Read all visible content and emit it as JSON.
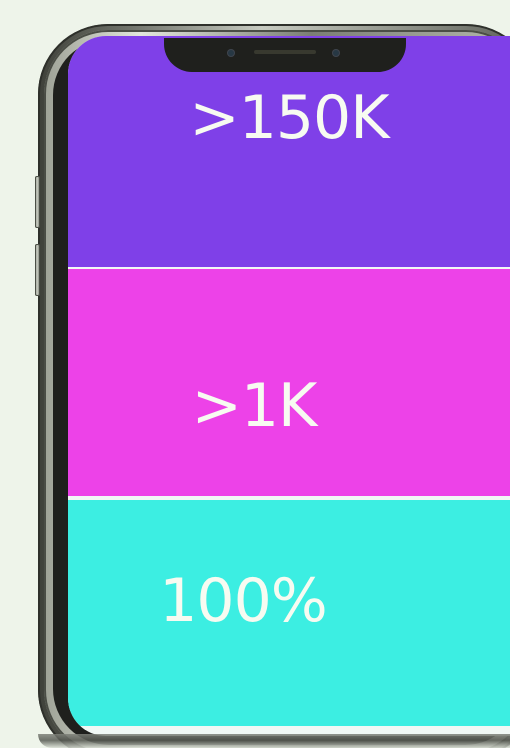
{
  "stats": [
    {
      "value": ">150K"
    },
    {
      "value": ">1K"
    },
    {
      "value": "100%"
    }
  ],
  "colors": {
    "background": "#eef4ea",
    "panel_1": "#7f40e8",
    "panel_2": "#ed42e8",
    "panel_3": "#3ceee2",
    "text": "#f7fbf1"
  },
  "icons": {
    "speaker": "speaker-grille-icon",
    "sensor_left": "camera-sensor-icon",
    "sensor_right": "camera-sensor-icon",
    "buttons": [
      "volume-up-button-icon",
      "volume-down-button-icon"
    ]
  }
}
